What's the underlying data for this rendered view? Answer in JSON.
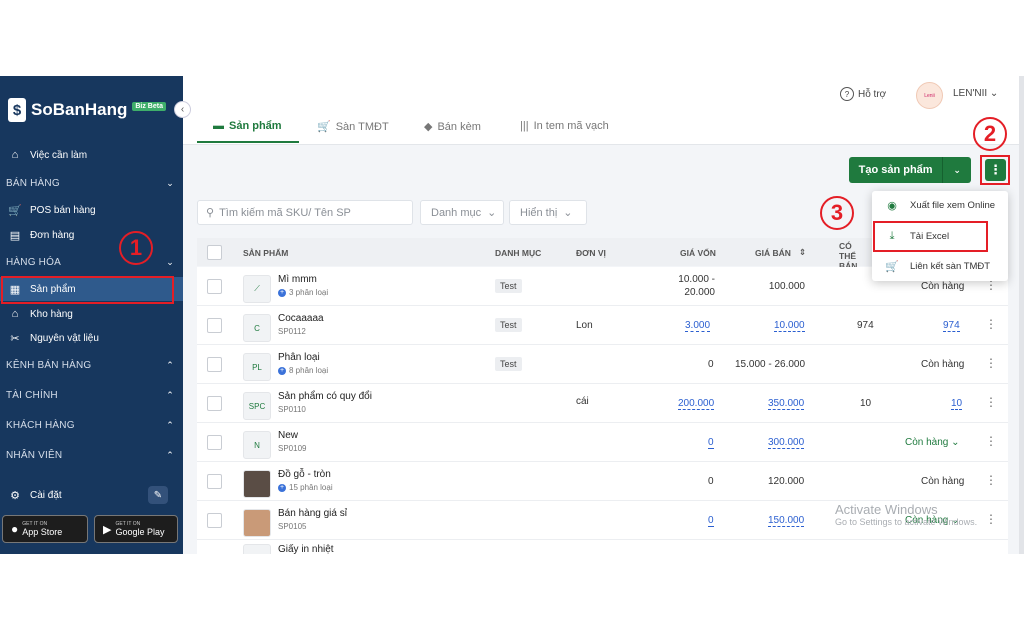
{
  "app": {
    "brand": "SoBanHang",
    "beta_badge": "Biz Beta"
  },
  "sidebar": {
    "todo": "Việc cần làm",
    "sections": {
      "sales": "BÁN HÀNG",
      "goods": "HÀNG HÓA",
      "channels": "KÊNH BÁN HÀNG",
      "finance": "TÀI CHÍNH",
      "customers": "KHÁCH HÀNG",
      "staff": "NHÂN VIÊN"
    },
    "items": {
      "pos": "POS bán hàng",
      "orders": "Đơn hàng",
      "products": "Sản phẩm",
      "warehouse": "Kho hàng",
      "materials": "Nguyên vật liệu",
      "settings": "Cài đặt"
    },
    "app_store": {
      "small": "GET IT ON",
      "big": "App Store"
    },
    "google_play": {
      "small": "GET IT ON",
      "big": "Google Play"
    }
  },
  "header": {
    "help": "Hỗ trợ",
    "user": "LEN'NII",
    "avatar_text": "Lenii"
  },
  "tabs": [
    "Sản phẩm",
    "Sàn TMĐT",
    "Bán kèm",
    "In tem mã vạch"
  ],
  "toolbar": {
    "create_label": "Tạo sản phẩm",
    "search_placeholder": "Tìm kiếm mã SKU/ Tên SP",
    "category_filter": "Danh mục",
    "display_filter": "Hiển thị"
  },
  "dropdown": {
    "export_online": "Xuất file xem Online",
    "download_excel": "Tải Excel",
    "link_ecommerce": "Liên kết sàn TMĐT"
  },
  "table": {
    "headers": {
      "product": "SẢN PHẨM",
      "category": "DANH MỤC",
      "unit": "ĐƠN VỊ",
      "cost": "GIÁ VỐN",
      "price": "GIÁ BÁN",
      "sellable": "CÓ THỂ BÁN"
    },
    "rows": [
      {
        "name": "Mì mmm",
        "sub": "3 phân loại",
        "category": "Test",
        "unit": "",
        "cost": "10.000 - 20.000",
        "price": "100.000",
        "sellable": "",
        "stock": "Còn hàng"
      },
      {
        "name": "Cocaaaaa",
        "sub": "SP0112",
        "category": "Test",
        "unit": "Lon",
        "cost": "3.000",
        "price": "10.000",
        "sellable": "974",
        "stock": "974"
      },
      {
        "name": "Phân loại",
        "sub": "8 phân loại",
        "category": "Test",
        "unit": "",
        "cost": "0",
        "price": "15.000 - 26.000",
        "sellable": "",
        "stock": "Còn hàng"
      },
      {
        "name": "Sản phẩm có quy đổi",
        "sub": "SP0110",
        "category": "",
        "unit": "cái",
        "cost": "200.000",
        "price": "350.000",
        "sellable": "10",
        "stock": "10"
      },
      {
        "name": "New",
        "sub": "SP0109",
        "category": "",
        "unit": "",
        "cost": "0",
        "price": "300.000",
        "sellable": "",
        "stock": "Còn hàng"
      },
      {
        "name": "Đồ gỗ - tròn",
        "sub": "15 phân loại",
        "category": "",
        "unit": "",
        "cost": "0",
        "price": "120.000",
        "sellable": "",
        "stock": "Còn hàng"
      },
      {
        "name": "Bán hàng giá sỉ",
        "sub": "SP0105",
        "category": "",
        "unit": "",
        "cost": "0",
        "price": "150.000",
        "sellable": "",
        "stock": "Còn hàng"
      },
      {
        "name": "Giấy in nhiệt",
        "sub": "",
        "category": "",
        "unit": "",
        "cost": "",
        "price": "",
        "sellable": "",
        "stock": ""
      }
    ],
    "thumbs": {
      "r1": "C",
      "r2": "PL",
      "r3": "SPC",
      "r4": "N"
    }
  },
  "annotations": {
    "step1": "1",
    "step2": "2",
    "step3": "3"
  },
  "watermark": {
    "line1": "Activate Windows",
    "line2": "Go to Settings to activate Windows."
  }
}
